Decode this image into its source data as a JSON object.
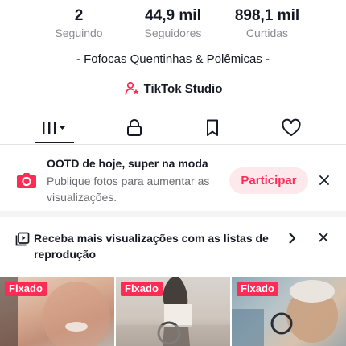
{
  "stats": [
    {
      "value": "2",
      "label": "Seguindo"
    },
    {
      "value": "44,9 mil",
      "label": "Seguidores"
    },
    {
      "value": "898,1 mil",
      "label": "Curtidas"
    }
  ],
  "bio": "- Fofocas Quentinhas & Polêmicas -",
  "studio": {
    "label": "TikTok Studio",
    "icon": "person-star-icon",
    "icon_color": "#fe2c55"
  },
  "tabs": [
    {
      "name": "videos",
      "icon": "grid-bars-icon"
    },
    {
      "name": "private",
      "icon": "lock-icon"
    },
    {
      "name": "favorites",
      "icon": "bookmark-icon"
    },
    {
      "name": "liked",
      "icon": "heart-icon"
    }
  ],
  "promo": {
    "title": "OOTD de hoje, super na moda",
    "body": "Publique fotos para aumentar as visualizações.",
    "button": "Participar",
    "icon": "camera-icon"
  },
  "playlist_banner": {
    "text": "Receba mais visualizações com as listas de reprodução",
    "icon": "playlist-icon"
  },
  "videos": [
    {
      "badge": "Fixado"
    },
    {
      "badge": "Fixado"
    },
    {
      "badge": "Fixado"
    }
  ],
  "colors": {
    "accent": "#fe2c55",
    "text": "#161823",
    "muted": "#8a8b91"
  }
}
